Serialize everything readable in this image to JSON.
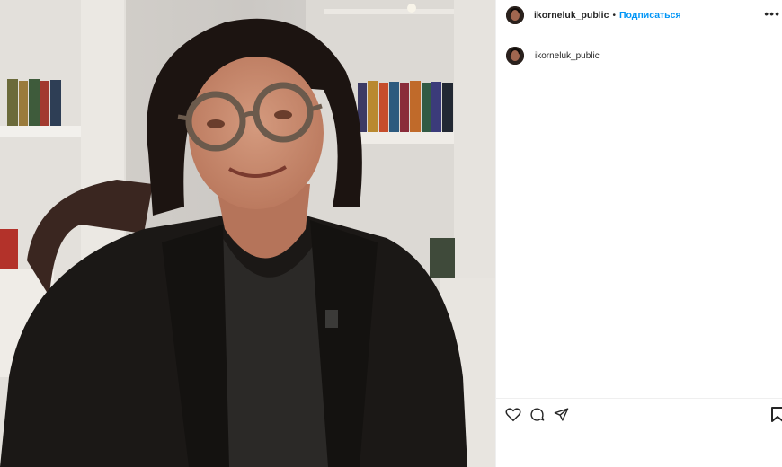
{
  "post": {
    "username": "ikorneluk_public",
    "follow_label": "Подписаться",
    "dot": "•",
    "more_glyph": "•••",
    "caption_username": "ikorneluk_public"
  },
  "icons": {
    "like": "heart-icon",
    "comment": "comment-icon",
    "share": "share-icon",
    "save": "bookmark-icon",
    "more": "more-options-icon"
  }
}
